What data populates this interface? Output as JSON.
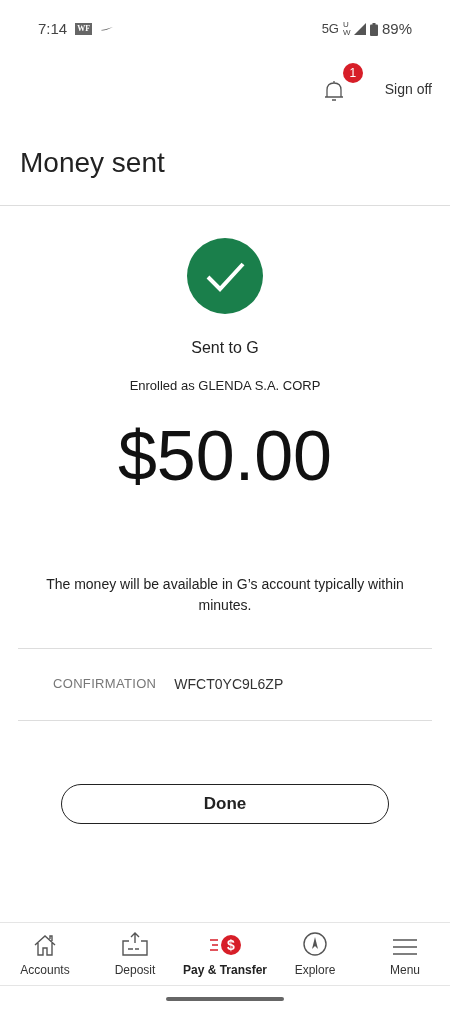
{
  "status_bar": {
    "time": "7:14",
    "app_badge": "WF",
    "network": "5G",
    "network_sub": "UW",
    "battery": "89%"
  },
  "header": {
    "notification_count": "1",
    "sign_off": "Sign off"
  },
  "title": "Money sent",
  "result": {
    "recipient": "Sent to G",
    "enrolled": "Enrolled as GLENDA S.A. CORP",
    "amount": "$50.00",
    "message": "The money will be available in G’s account typically within minutes."
  },
  "confirmation": {
    "label": "CONFIRMATION",
    "value": "WFCT0YC9L6ZP"
  },
  "done_button": "Done",
  "nav": [
    {
      "kind": "accounts",
      "label": "Accounts",
      "selected": false
    },
    {
      "kind": "deposit",
      "label": "Deposit",
      "selected": false
    },
    {
      "kind": "pay",
      "label": "Pay & Transfer",
      "icon_text": "$",
      "selected": true
    },
    {
      "kind": "explore",
      "label": "Explore",
      "selected": false
    },
    {
      "kind": "menu",
      "label": "Menu",
      "selected": false
    }
  ]
}
